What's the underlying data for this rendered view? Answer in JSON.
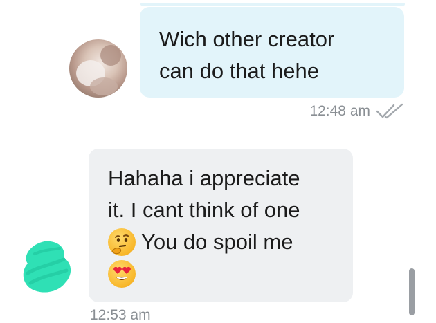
{
  "messages": [
    {
      "direction": "outgoing",
      "text": "Wich other creator\ncan do that hehe",
      "time": "12:48 am",
      "status_icon": "double-check-icon",
      "bubble_color": "#e2f4fa"
    },
    {
      "direction": "incoming",
      "lines": [
        {
          "text": "Hahaha i appreciate"
        },
        {
          "text": "it. I cant think of one"
        },
        {
          "emoji": "thinking-face-icon",
          "text": "You do spoil me"
        },
        {
          "emoji": "heart-eyes-face-icon",
          "text": ""
        }
      ],
      "time": "12:53 am",
      "bubble_color": "#eef0f2"
    }
  ],
  "colors": {
    "timestamp": "#8a8f94",
    "redaction": "#2fe0b5",
    "text": "#1b1b1b"
  }
}
